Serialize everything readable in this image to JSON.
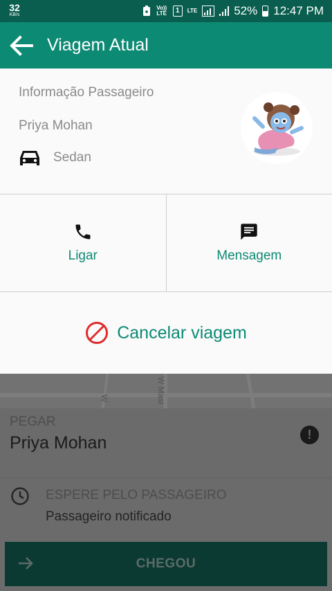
{
  "status_bar": {
    "net_speed": "32",
    "net_speed_unit": "KB/s",
    "sim_indicator": "1",
    "volte": "Vo)) LTE",
    "lte": "LTE",
    "battery": "52%",
    "time": "12:47 PM"
  },
  "app_bar": {
    "title": "Viagem Atual",
    "back_icon": "arrow-left-icon"
  },
  "passenger": {
    "section_label": "Informação Passageiro",
    "name": "Priya Mohan",
    "vehicle_type": "Sedan",
    "vehicle_icon": "car-icon"
  },
  "actions": {
    "call_label": "Ligar",
    "message_label": "Mensagem",
    "cancel_label": "Cancelar viagem"
  },
  "map": {
    "street_label": "W Masi",
    "street_label_2": "W"
  },
  "pickup": {
    "label": "PEGAR",
    "name": "Priya Mohan",
    "wait_title": "ESPERE PELO PASSAGEIRO",
    "wait_subtitle": "Passageiro notificado",
    "arrived_label": "CHEGOU"
  },
  "colors": {
    "primary": "#0d8a74",
    "status_bar": "#0a5e4f",
    "cancel_red": "#e02b2b"
  }
}
